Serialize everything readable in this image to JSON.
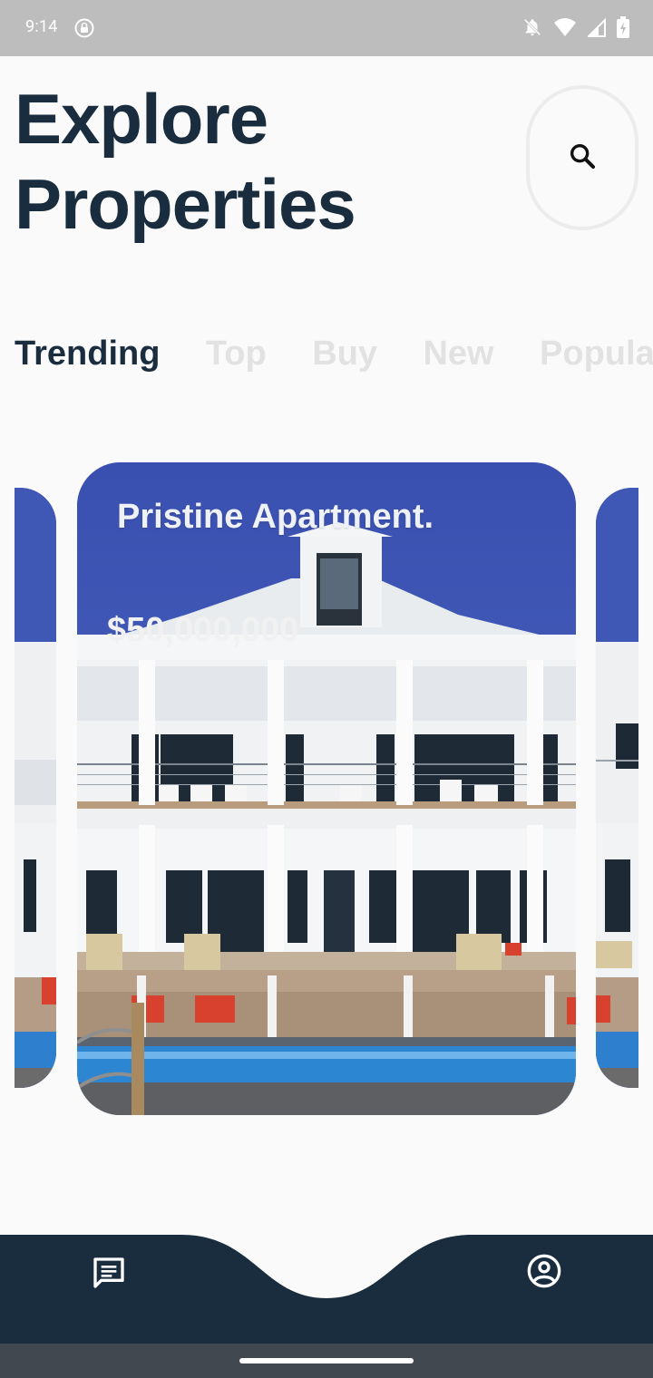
{
  "status_bar": {
    "time": "9:14",
    "icons": [
      "lock-icon",
      "notifications-off-icon",
      "wifi-icon",
      "signal-icon",
      "battery-icon"
    ]
  },
  "header": {
    "title": "Explore\nProperties",
    "search_icon": "search-icon"
  },
  "tabs": [
    {
      "label": "Trending",
      "active": true
    },
    {
      "label": "Top",
      "active": false
    },
    {
      "label": "Buy",
      "active": false
    },
    {
      "label": "New",
      "active": false
    },
    {
      "label": "Popular",
      "active": false
    }
  ],
  "cards": {
    "current": {
      "name": "Pristine Apartment.",
      "price": "$50,000,000"
    }
  },
  "bottom_nav": {
    "items": [
      {
        "icon": "chat-icon"
      },
      {
        "icon": "account-circle-icon"
      }
    ]
  },
  "colors": {
    "primary_dark": "#1a2d3f",
    "tab_inactive": "#e2e2e2",
    "background": "#fafafa",
    "sky": "#3f58b6"
  }
}
